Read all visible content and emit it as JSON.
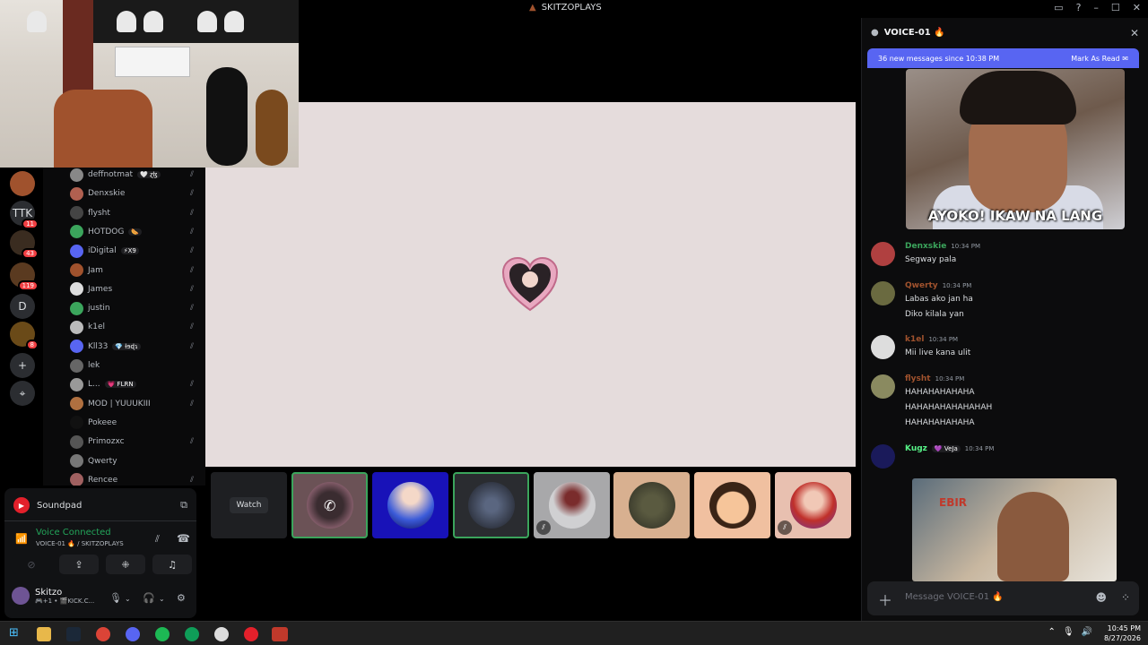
{
  "window": {
    "title": "SKITZOPLAYS",
    "title_icon": "poop-emoji"
  },
  "servers": [
    {
      "label": "",
      "badge": "",
      "icon": "poop-emoji"
    },
    {
      "label": "TTK",
      "badge": "11"
    },
    {
      "label": "",
      "badge": "43"
    },
    {
      "label": "",
      "badge": "119"
    },
    {
      "label": "D",
      "badge": ""
    },
    {
      "label": "",
      "badge": "8"
    },
    {
      "label": "+",
      "badge": ""
    },
    {
      "label": "⌖",
      "badge": ""
    }
  ],
  "voice_members": [
    {
      "name": "deffnotmat",
      "tag": "🤍 ɀɮ",
      "muted": true
    },
    {
      "name": "Denxskie",
      "tag": "",
      "muted": true
    },
    {
      "name": "flysht",
      "tag": "",
      "muted": true
    },
    {
      "name": "HOTDOG",
      "tag": "🌭",
      "muted": true
    },
    {
      "name": "iDigital",
      "tag": "⚡X9",
      "muted": true
    },
    {
      "name": "Jam",
      "tag": "",
      "muted": true
    },
    {
      "name": "James",
      "tag": "",
      "muted": true
    },
    {
      "name": "justin",
      "tag": "",
      "muted": true
    },
    {
      "name": "k1el",
      "tag": "",
      "muted": true
    },
    {
      "name": "Kll33",
      "tag": "💎 ƚɘɖɿ",
      "muted": true
    },
    {
      "name": "lek",
      "tag": "",
      "muted": false
    },
    {
      "name": "L...",
      "tag": "💗 FLRN",
      "muted": true
    },
    {
      "name": "MOD | YUUUKIII",
      "tag": "",
      "muted": true
    },
    {
      "name": "Pokeee",
      "tag": "",
      "muted": false
    },
    {
      "name": "Primozxc",
      "tag": "",
      "muted": true
    },
    {
      "name": "Qwerty",
      "tag": "",
      "muted": false
    },
    {
      "name": "Rencee",
      "tag": "",
      "muted": true
    }
  ],
  "panel": {
    "soundpad_label": "Soundpad",
    "voice_status": "Voice Connected",
    "voice_channel": "VOICE-01 🔥 / SKITZOPLAYS",
    "user_name": "Skitzo",
    "user_status": "🎮+1 • 🎬KICK.C..."
  },
  "stage": {
    "watch_label": "Watch"
  },
  "chat": {
    "channel": "VOICE-01 🔥",
    "new_messages": "36 new messages since 10:38 PM",
    "mark_read": "Mark As Read",
    "gif_caption": "AYOKO! IKAW NA LANG",
    "messages": [
      {
        "author": "Denxskie",
        "time": "10:34 PM",
        "color": "#3ba55c",
        "lines": [
          "Segway pala"
        ]
      },
      {
        "author": "Qwerty",
        "time": "10:34 PM",
        "color": "#a0522d",
        "lines": [
          "Labas ako jan ha",
          "Diko kilala yan"
        ]
      },
      {
        "author": "k1el",
        "time": "10:34 PM",
        "color": "#a0522d",
        "lines": [
          "Mii live kana ulit"
        ]
      },
      {
        "author": "flysht",
        "time": "10:34 PM",
        "color": "#a0522d",
        "lines": [
          "HAHAHAHAHAHA",
          "HAHAHAHAHAHAHAH",
          "HAHAHAHAHAHA"
        ]
      },
      {
        "author": "Kugz",
        "time": "10:34 PM",
        "color": "#57f287",
        "lines": [],
        "tag": "💜 VeJa"
      }
    ],
    "gif2_sign": "EBIR",
    "composer_placeholder": "Message VOICE-01 🔥"
  },
  "taskbar": {
    "time": "10:45 PM",
    "date": "8/27/2026"
  }
}
